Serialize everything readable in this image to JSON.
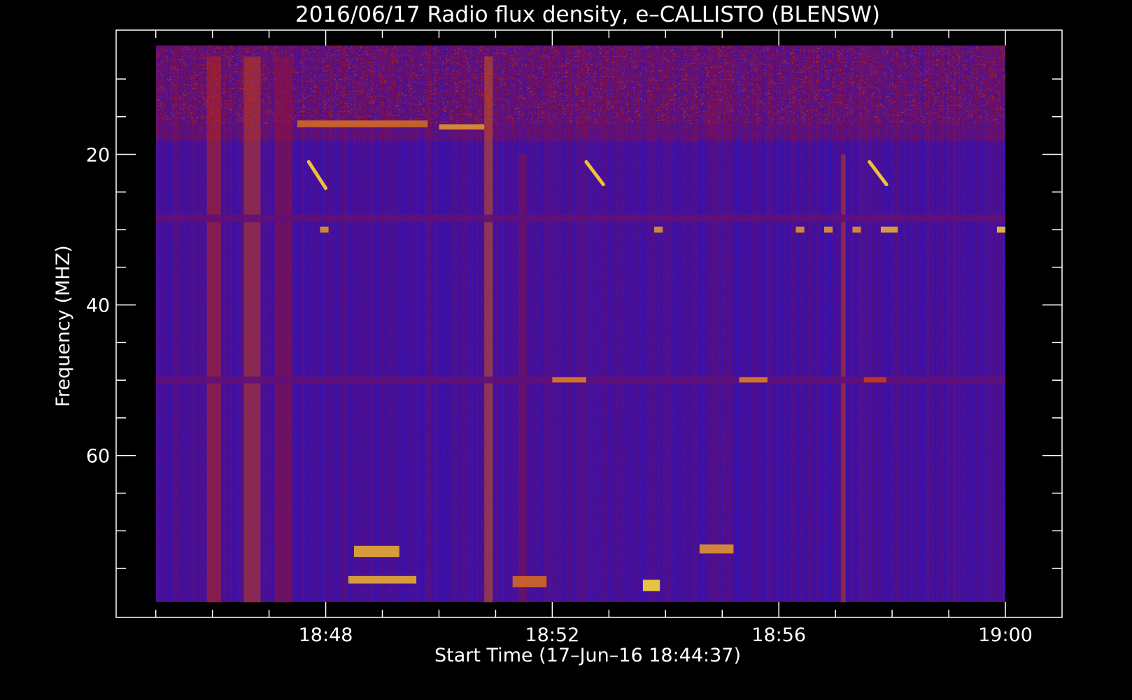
{
  "chart_data": {
    "type": "heatmap",
    "title": "2016/06/17  Radio flux density, e–CALLISTO (BLENSW)",
    "xlabel": "Start Time (17–Jun–16 18:44:37)",
    "ylabel": "Frequency (MHZ)",
    "x_tick_labels": [
      "18:48",
      "18:52",
      "18:56",
      "19:00"
    ],
    "x_tick_minutes": [
      228,
      232,
      236,
      240
    ],
    "x_minor_minutes": [
      225,
      226,
      227,
      229,
      230,
      231,
      233,
      234,
      235,
      237,
      238,
      239
    ],
    "xlim_minutes": [
      224.3,
      241.0
    ],
    "data_x_range_minutes": [
      225.0,
      240.0
    ],
    "y_tick_labels": [
      "20",
      "40",
      "60"
    ],
    "y_tick_values": [
      20,
      40,
      60
    ],
    "y_minor_values": [
      10,
      15,
      25,
      30,
      35,
      45,
      50,
      55,
      65,
      70,
      75
    ],
    "ylim": [
      3.5,
      81.5
    ],
    "data_y_range": [
      5.5,
      79.5
    ],
    "y_inverted": true,
    "grid": false,
    "colormap": {
      "low": "#1010e0",
      "mid": "#b01010",
      "high": "#ffee40",
      "background": "#000000",
      "axis": "#ffffff"
    },
    "bursts": [
      {
        "type": "broadband",
        "x_start": 225.9,
        "x_end": 226.15,
        "y_start": 7,
        "y_end": 79.5,
        "intensity": 0.55
      },
      {
        "type": "broadband",
        "x_start": 226.55,
        "x_end": 226.85,
        "y_start": 7,
        "y_end": 79.5,
        "intensity": 0.6
      },
      {
        "type": "broadband",
        "x_start": 227.1,
        "x_end": 227.4,
        "y_start": 7,
        "y_end": 79.5,
        "intensity": 0.4
      },
      {
        "type": "broadband",
        "x_start": 230.8,
        "x_end": 230.95,
        "y_start": 7,
        "y_end": 79.5,
        "intensity": 0.65
      },
      {
        "type": "broadband",
        "x_start": 231.4,
        "x_end": 231.55,
        "y_start": 20,
        "y_end": 79.5,
        "intensity": 0.35
      },
      {
        "type": "broadband",
        "x_start": 237.1,
        "x_end": 237.18,
        "y_start": 20,
        "y_end": 79.5,
        "intensity": 0.6
      },
      {
        "type": "band",
        "x_start": 225.0,
        "x_end": 240.0,
        "y_start": 49.5,
        "y_end": 50.4,
        "intensity": 0.25
      },
      {
        "type": "band",
        "x_start": 232.0,
        "x_end": 232.6,
        "y_start": 49.6,
        "y_end": 50.3,
        "intensity": 0.75
      },
      {
        "type": "band",
        "x_start": 235.3,
        "x_end": 235.8,
        "y_start": 49.6,
        "y_end": 50.3,
        "intensity": 0.75
      },
      {
        "type": "band",
        "x_start": 237.5,
        "x_end": 237.9,
        "y_start": 49.6,
        "y_end": 50.3,
        "intensity": 0.6
      },
      {
        "type": "band",
        "x_start": 227.5,
        "x_end": 229.8,
        "y_start": 15.5,
        "y_end": 16.4,
        "intensity": 0.7
      },
      {
        "type": "band",
        "x_start": 230.0,
        "x_end": 230.8,
        "y_start": 16.0,
        "y_end": 16.7,
        "intensity": 0.8
      },
      {
        "type": "band",
        "x_start": 228.5,
        "x_end": 229.3,
        "y_start": 72.0,
        "y_end": 73.5,
        "intensity": 0.85
      },
      {
        "type": "band",
        "x_start": 228.4,
        "x_end": 229.6,
        "y_start": 76.0,
        "y_end": 77.0,
        "intensity": 0.85
      },
      {
        "type": "band",
        "x_start": 231.3,
        "x_end": 231.9,
        "y_start": 76.0,
        "y_end": 77.5,
        "intensity": 0.7
      },
      {
        "type": "band",
        "x_start": 233.6,
        "x_end": 233.9,
        "y_start": 76.5,
        "y_end": 78.0,
        "intensity": 0.95
      },
      {
        "type": "band",
        "x_start": 234.6,
        "x_end": 235.2,
        "y_start": 71.8,
        "y_end": 73.0,
        "intensity": 0.8
      },
      {
        "type": "band",
        "x_start": 225.0,
        "x_end": 240.0,
        "y_start": 28.0,
        "y_end": 29.0,
        "intensity": 0.25
      },
      {
        "type": "spot",
        "x_start": 227.9,
        "x_end": 228.05,
        "y_start": 29.6,
        "y_end": 30.4,
        "intensity": 0.8
      },
      {
        "type": "spot",
        "x_start": 233.8,
        "x_end": 233.95,
        "y_start": 29.6,
        "y_end": 30.4,
        "intensity": 0.8
      },
      {
        "type": "spot",
        "x_start": 236.3,
        "x_end": 236.45,
        "y_start": 29.6,
        "y_end": 30.4,
        "intensity": 0.8
      },
      {
        "type": "spot",
        "x_start": 236.8,
        "x_end": 236.95,
        "y_start": 29.6,
        "y_end": 30.4,
        "intensity": 0.8
      },
      {
        "type": "spot",
        "x_start": 237.3,
        "x_end": 237.45,
        "y_start": 29.6,
        "y_end": 30.4,
        "intensity": 0.8
      },
      {
        "type": "spot",
        "x_start": 237.8,
        "x_end": 238.1,
        "y_start": 29.6,
        "y_end": 30.4,
        "intensity": 0.85
      },
      {
        "type": "spot",
        "x_start": 239.85,
        "x_end": 240.0,
        "y_start": 29.6,
        "y_end": 30.4,
        "intensity": 0.9
      },
      {
        "type": "drift",
        "x_start": 227.7,
        "x_end": 228.0,
        "y_start": 21.0,
        "y_end": 24.5,
        "intensity": 0.9
      },
      {
        "type": "drift",
        "x_start": 232.6,
        "x_end": 232.9,
        "y_start": 21.0,
        "y_end": 24.0,
        "intensity": 0.9
      },
      {
        "type": "drift",
        "x_start": 237.6,
        "x_end": 237.9,
        "y_start": 21.0,
        "y_end": 24.0,
        "intensity": 0.9
      }
    ]
  }
}
